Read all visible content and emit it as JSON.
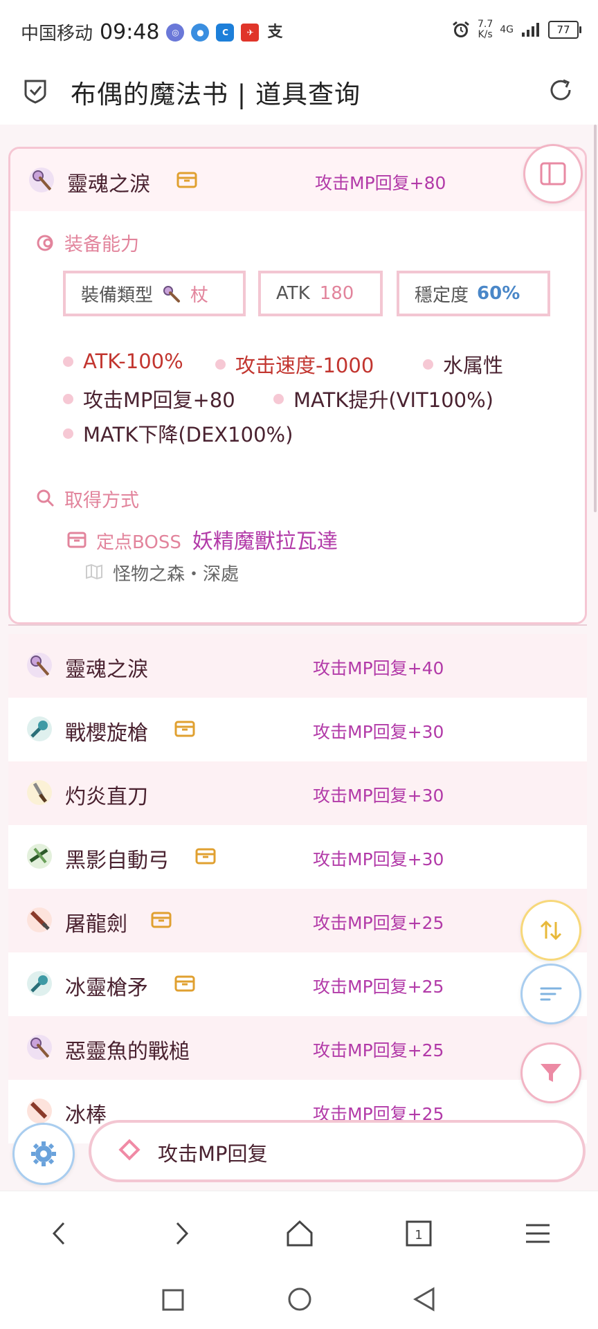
{
  "status_bar": {
    "carrier": "中国移动",
    "time": "09:48",
    "net_speed_value": "7.7",
    "net_speed_unit": "K/s",
    "signal": "4G",
    "battery": "77"
  },
  "header": {
    "title": "布偶的魔法书 | 道具查询"
  },
  "detail": {
    "name": "靈魂之淚",
    "stat": "攻击MP回复+80",
    "equip_section": "装备能力",
    "type_label": "裝備類型",
    "type_value": "杖",
    "atk_label": "ATK",
    "atk_value": "180",
    "stability_label": "穩定度",
    "stability_value": "60%",
    "effects_red": [
      "ATK-100%",
      "攻击速度-1000"
    ],
    "effects_dark": [
      "水属性",
      "攻击MP回复+80",
      "MATK提升(VIT100%)",
      "MATK下降(DEX100%)"
    ],
    "obtain_section": "取得方式",
    "obtain_type": "定点BOSS",
    "obtain_boss": "妖精魔獸拉瓦達",
    "obtain_location": "怪物之森・深處"
  },
  "items": [
    {
      "name": "靈魂之淚",
      "stat": "攻击MP回复+40",
      "icon": "staff-icon",
      "has_box": false
    },
    {
      "name": "戰櫻旋槍",
      "stat": "攻击MP回复+30",
      "icon": "halberd-icon",
      "has_box": true
    },
    {
      "name": "灼炎直刀",
      "stat": "攻击MP回复+30",
      "icon": "katana-icon",
      "has_box": false
    },
    {
      "name": "黑影自動弓",
      "stat": "攻击MP回复+30",
      "icon": "bowgun-icon",
      "has_box": true
    },
    {
      "name": "屠龍劍",
      "stat": "攻击MP回复+25",
      "icon": "sword-icon",
      "has_box": true
    },
    {
      "name": "冰靈槍矛",
      "stat": "攻击MP回复+25",
      "icon": "halberd-icon",
      "has_box": true
    },
    {
      "name": "惡靈魚的戰槌",
      "stat": "攻击MP回复+25",
      "icon": "staff-icon",
      "has_box": false
    },
    {
      "name": "冰棒",
      "stat": "攻击MP回复+25",
      "icon": "sword-icon",
      "has_box": false
    }
  ],
  "search": {
    "query": "攻击MP回复"
  },
  "colors": {
    "accent_pink": "#f3c6d2",
    "stat_purple": "#b23aa8",
    "red": "#c2352f",
    "blue": "#4a87c8"
  }
}
